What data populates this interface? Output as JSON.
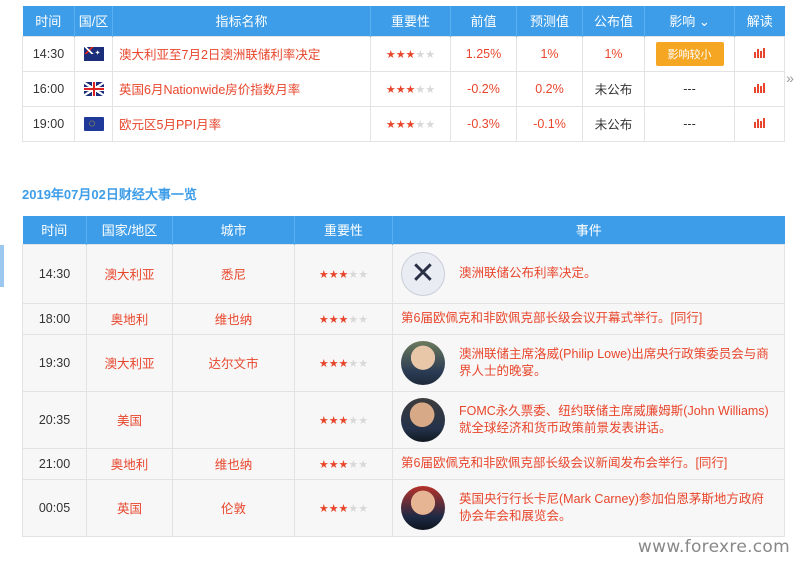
{
  "top_table": {
    "headers": [
      "时间",
      "国/区",
      "指标名称",
      "重要性",
      "前值",
      "预测值",
      "公布值",
      "影响 ⌄",
      "解读"
    ],
    "rows": [
      {
        "time": "14:30",
        "flag": "australia-flag",
        "name": "澳大利亚至7月2日澳洲联储利率决定",
        "stars_on": 3,
        "prev": "1.25%",
        "forecast": "1%",
        "actual": "1%",
        "impact": "影响较小",
        "interp_icon": "bar-chart-icon"
      },
      {
        "time": "16:00",
        "flag": "uk-flag",
        "name": "英国6月Nationwide房价指数月率",
        "stars_on": 3,
        "prev": "-0.2%",
        "forecast": "0.2%",
        "actual": "未公布",
        "impact": "---",
        "interp_icon": "bar-chart-icon"
      },
      {
        "time": "19:00",
        "flag": "eu-flag",
        "name": "欧元区5月PPI月率",
        "stars_on": 3,
        "prev": "-0.3%",
        "forecast": "-0.1%",
        "actual": "未公布",
        "impact": "---",
        "interp_icon": "bar-chart-icon"
      }
    ]
  },
  "section_title": "2019年07月02日财经大事一览",
  "events_table": {
    "headers": [
      "时间",
      "国家/地区",
      "城市",
      "重要性",
      "事件"
    ],
    "rows": [
      {
        "time": "14:30",
        "country": "澳大利亚",
        "city": "悉尼",
        "stars_on": 3,
        "avatar": "rba-logo",
        "event": "澳洲联储公布利率决定。"
      },
      {
        "time": "18:00",
        "country": "奥地利",
        "city": "维也纳",
        "stars_on": 3,
        "avatar": "",
        "event": "第6届欧佩克和非欧佩克部长级会议开幕式举行。[同行]"
      },
      {
        "time": "19:30",
        "country": "澳大利亚",
        "city": "达尔文市",
        "stars_on": 3,
        "avatar": "person-photo",
        "event": "澳洲联储主席洛威(Philip Lowe)出席央行政策委员会与商界人士的晚宴。"
      },
      {
        "time": "20:35",
        "country": "美国",
        "city": "",
        "stars_on": 3,
        "avatar": "person-photo",
        "event": "FOMC永久票委、纽约联储主席威廉姆斯(John Williams)就全球经济和货币政策前景发表讲话。"
      },
      {
        "time": "21:00",
        "country": "奥地利",
        "city": "维也纳",
        "stars_on": 3,
        "avatar": "",
        "event": "第6届欧佩克和非欧佩克部长级会议新闻发布会举行。[同行]"
      },
      {
        "time": "00:05",
        "country": "英国",
        "city": "伦敦",
        "stars_on": 3,
        "avatar": "person-photo",
        "event": "英国央行行长卡尼(Mark Carney)参加伯恩茅斯地方政府协会年会和展览会。"
      }
    ]
  },
  "watermark": "www.forexre.com",
  "colors": {
    "header_blue": "#3d9de8",
    "accent_red": "#e8462c",
    "impact_orange": "#f5a623"
  }
}
